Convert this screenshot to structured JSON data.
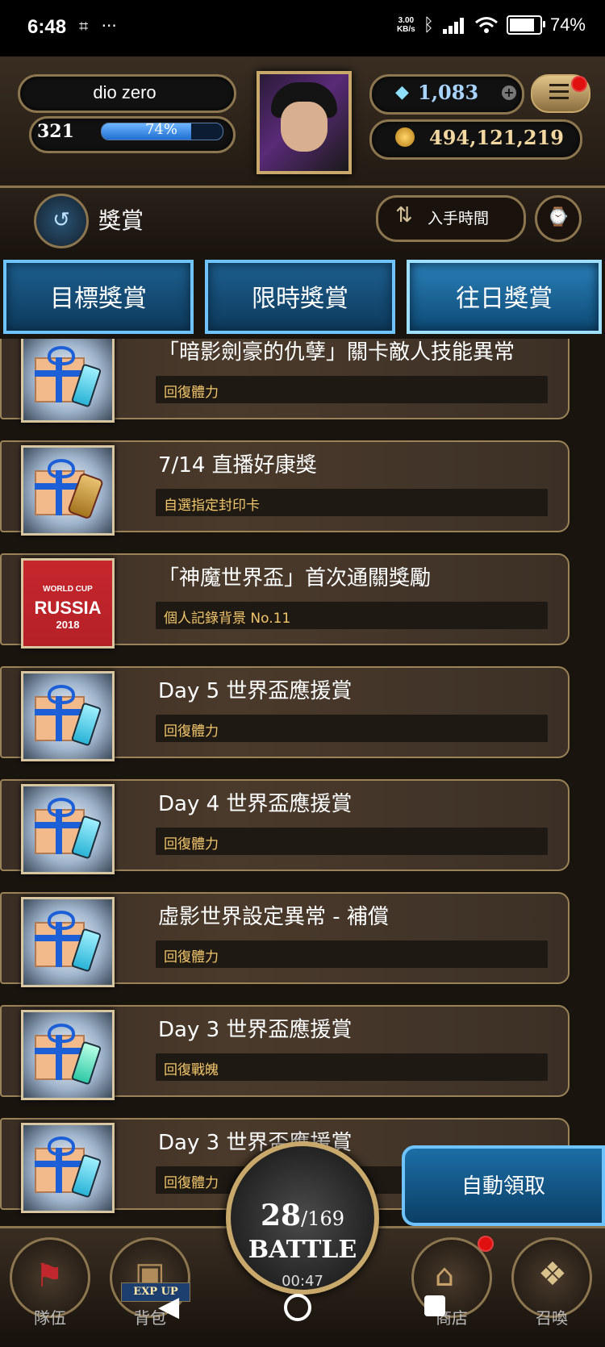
{
  "status_bar": {
    "time": "6:48",
    "net_speed_value": "3.00",
    "net_speed_unit": "KB/s",
    "battery": "74%",
    "battery_level": 0.74
  },
  "header": {
    "player_name": "dio zero",
    "level": "321",
    "exp_percent_text": "74%",
    "exp_fraction": 0.74,
    "gems": "1,083",
    "coins": "494,121,219",
    "menu_icon": "hamburger-menu-icon"
  },
  "titlebar": {
    "title": "獎賞",
    "sort_label": "入手時間",
    "back_icon": "back-arrow-icon",
    "filter_icon": "filter-clock-icon"
  },
  "tabs": [
    {
      "label": "目標獎賞"
    },
    {
      "label": "限時獎賞"
    },
    {
      "label": "往日獎賞"
    }
  ],
  "rewards": [
    {
      "title": "「暗影劍豪的仇孽」關卡敵人技能異常",
      "sub": "回復體力",
      "icon": "gift-potion-icon"
    },
    {
      "title": "7/14 直播好康獎",
      "sub": "自選指定封印卡",
      "icon": "gift-scroll-icon"
    },
    {
      "title": "「神魔世界盃」首次通關獎勵",
      "sub": "個人記錄背景 No.11",
      "icon": "worldcup-russia-icon",
      "badge_lines": [
        "WORLD CUP",
        "RUSSIA",
        "2018"
      ]
    },
    {
      "title": "Day 5 世界盃應援賞",
      "sub": "回復體力",
      "icon": "gift-potion-icon"
    },
    {
      "title": "Day 4 世界盃應援賞",
      "sub": "回復體力",
      "icon": "gift-potion-icon"
    },
    {
      "title": "虛影世界設定異常 - 補償",
      "sub": "回復體力",
      "icon": "gift-potion-icon"
    },
    {
      "title": "Day 3 世界盃應援賞",
      "sub": "回復戰魄",
      "icon": "gift-crystal-icon"
    },
    {
      "title": "Day 3 世界盃應援賞",
      "sub": "回復體力",
      "icon": "gift-potion-icon"
    }
  ],
  "auto_claim_label": "自動領取",
  "battle": {
    "current": "28",
    "max": "169",
    "label": "BATTLE",
    "timer": "00:47"
  },
  "bottom_nav": [
    {
      "label": "隊伍",
      "icon": "flag-icon"
    },
    {
      "label": "背包",
      "icon": "backpack-icon",
      "badge": "EXP UP"
    },
    {
      "label": "商店",
      "icon": "shop-icon"
    },
    {
      "label": "召喚",
      "icon": "summon-card-icon"
    }
  ],
  "colors": {
    "tab_blue": "#1d5f8f",
    "gold_border": "#8c7650",
    "subtitle_gold": "#f2c66a",
    "notification_red": "#e01010"
  }
}
